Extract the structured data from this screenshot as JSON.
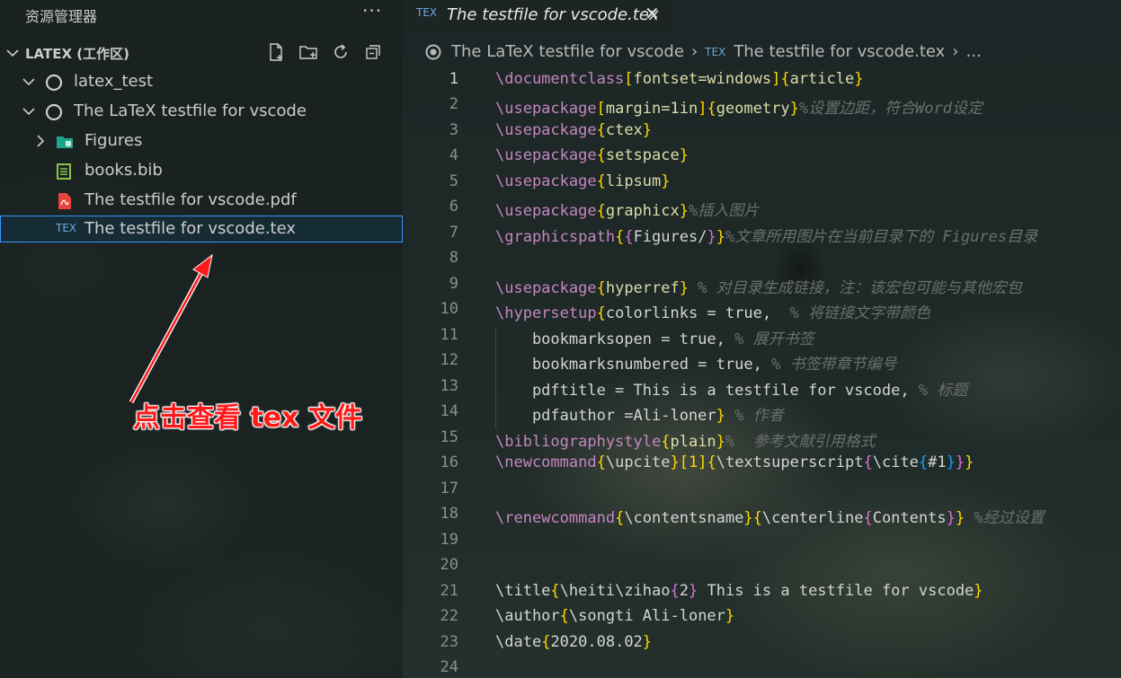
{
  "sidebar": {
    "title": "资源管理器",
    "more": "···",
    "workspace": "LATEX (工作区)",
    "items": [
      {
        "label": "latex_test"
      },
      {
        "label": "The LaTeX testfile for vscode"
      },
      {
        "label": "Figures"
      },
      {
        "label": "books.bib"
      },
      {
        "label": "The testfile for vscode.pdf"
      },
      {
        "label": "The testfile for vscode.tex"
      }
    ]
  },
  "annotation": "点击查看  tex 文件",
  "tab": {
    "label": "The testfile for vscode.tex",
    "close": "✕",
    "icon": "TEX"
  },
  "breadcrumbs": {
    "folder": "The LaTeX testfile for vscode",
    "file": "The testfile for vscode.tex",
    "more": "..."
  },
  "colors": {
    "command": "#c586c0",
    "brace_level1": "#ffd700",
    "brace_level2": "#da70d6",
    "brace_level3": "#179fff",
    "argument": "#dcdcaa",
    "comment": "#6a6f6f",
    "annotation": "#ff1a1a",
    "selection_border": "#3794ff"
  },
  "code": {
    "line_numbers": [
      "1",
      "2",
      "3",
      "4",
      "5",
      "6",
      "7",
      "8",
      "9",
      "10",
      "11",
      "12",
      "13",
      "14",
      "15",
      "16",
      "17",
      "18",
      "19",
      "20",
      "21",
      "22",
      "23",
      "24"
    ],
    "t_documentclass": "\\documentclass",
    "t_fontset": "fontset=windows",
    "t_article": "article",
    "t_usepackage": "\\usepackage",
    "t_margin": "margin=1in",
    "t_geometry": "geometry",
    "t_c2": "%设置边距，符合Word设定",
    "t_ctex": "ctex",
    "t_setspace": "setspace",
    "t_lipsum": "lipsum",
    "t_graphicx": "graphicx",
    "t_c6": "%插入图片",
    "t_graphicspath": "\\graphicspath",
    "t_figures": "Figures/",
    "t_c7": "%文章所用图片在当前目录下的 Figures目录",
    "t_hyperref": "hyperref",
    "t_c9": " % 对目录生成链接，注：该宏包可能与其他宏包",
    "t_hypersetup": "\\hypersetup",
    "t_colorlinks": "colorlinks = true,  ",
    "t_c10": "% 将链接文字带颜色",
    "t_bmopen": "    bookmarksopen = true, ",
    "t_c11": "% 展开书签",
    "t_bmnum": "    bookmarksnumbered = true, ",
    "t_c12": "% 书签带章节编号",
    "t_pdftitle": "    pdftitle = This is a testfile for vscode, ",
    "t_c13": "% 标题",
    "t_pdfauthor": "    pdfauthor =Ali-loner",
    "t_c14": " % 作者",
    "t_bibstyle": "\\bibliographystyle",
    "t_plain": "plain",
    "t_c15": "%  参考文献引用格式",
    "t_newcommand": "\\newcommand",
    "t_upcite": "\\upcite",
    "t_opt1": "[1]",
    "t_textsuperscript": "\\textsuperscript",
    "t_cite": "\\cite",
    "t_arg1": "#1",
    "t_renewcommand": "\\renewcommand",
    "t_contentsname": "\\contentsname",
    "t_centerline": "\\centerline",
    "t_contents": "Contents",
    "t_c18": " %经过设置",
    "t_title": "\\title",
    "t_heiti": "\\heiti\\zihao",
    "t_two": "2",
    "t_titletext": " This is a testfile for vscode",
    "t_author": "\\author",
    "t_songti": "\\songti Ali-loner",
    "t_date": "\\date",
    "t_datev": "2020.08.02"
  }
}
